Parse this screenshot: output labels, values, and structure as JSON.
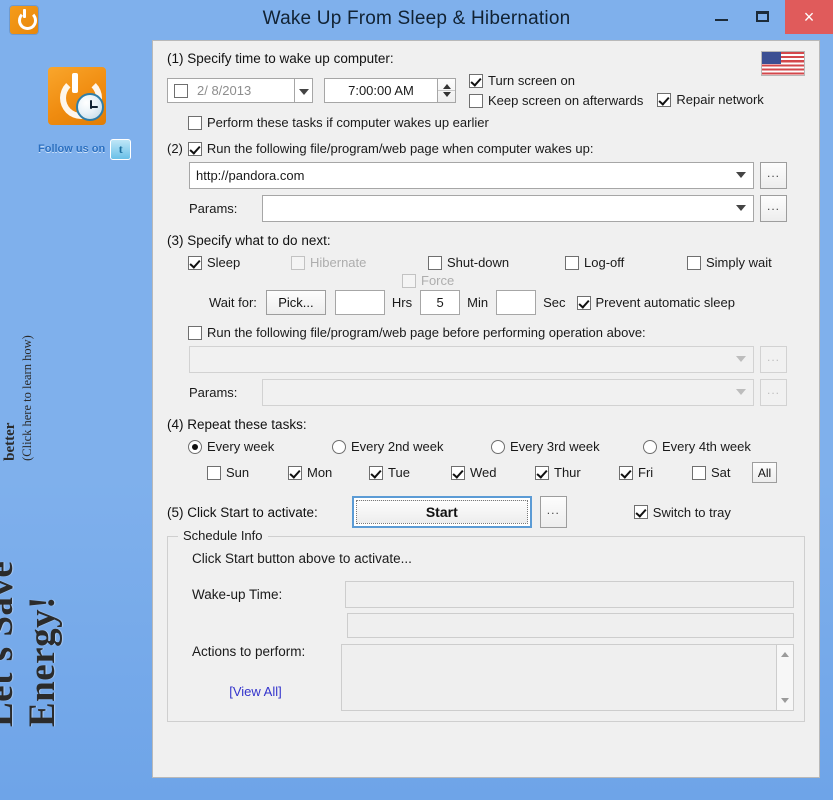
{
  "window": {
    "title": "Wake Up From Sleep & Hibernation",
    "minimize_label": "Minimize",
    "maximize_label": "Maximize",
    "close_label": "×"
  },
  "sidebar": {
    "follow_text": "Follow us on",
    "twitter_glyph": "t",
    "banner_line1": "Let's Save Energy!",
    "banner_line2": "& make this software better",
    "banner_line3": "(Click here to learn how)"
  },
  "section1": {
    "title": "(1) Specify time to wake up computer:",
    "date_enabled": false,
    "date_value": "2/ 8/2013",
    "time_value": "7:00:00 AM",
    "turn_screen_on": {
      "label": "Turn screen on",
      "checked": true
    },
    "keep_screen_on": {
      "label": "Keep screen on afterwards",
      "checked": false
    },
    "repair_network": {
      "label": "Repair network",
      "checked": true
    },
    "perform_earlier": {
      "label": "Perform these tasks if computer wakes up earlier",
      "checked": false
    },
    "flag_icon": "us-flag-icon"
  },
  "section2": {
    "title": "Run the following file/program/web page when computer wakes up:",
    "number": "(2)",
    "checked": true,
    "url_value": "http://pandora.com",
    "params_label": "Params:",
    "params_value": "",
    "browse_label": "..."
  },
  "section3": {
    "title": "(3) Specify what to do next:",
    "options": [
      {
        "label": "Sleep",
        "checked": true,
        "disabled": false
      },
      {
        "label": "Hibernate",
        "checked": false,
        "disabled": true
      },
      {
        "label": "Shut-down",
        "checked": false,
        "disabled": false
      },
      {
        "label": "Log-off",
        "checked": false,
        "disabled": false
      },
      {
        "label": "Simply wait",
        "checked": false,
        "disabled": false
      }
    ],
    "wait_for_label": "Wait for:",
    "pick_label": "Pick...",
    "hrs_value": "",
    "hrs_label": "Hrs",
    "min_value": "5",
    "min_label": "Min",
    "sec_value": "",
    "sec_label": "Sec",
    "force": {
      "label": "Force",
      "checked": false,
      "disabled": true
    },
    "prevent_sleep": {
      "label": "Prevent automatic sleep",
      "checked": true
    },
    "pre_run": {
      "label": "Run the following file/program/web page before performing operation above:",
      "checked": false
    },
    "pre_path_value": "",
    "pre_params_label": "Params:",
    "pre_params_value": "",
    "browse_label": "..."
  },
  "section4": {
    "title": "(4) Repeat these tasks:",
    "frequencies": [
      {
        "label": "Every week",
        "selected": true
      },
      {
        "label": "Every 2nd week",
        "selected": false
      },
      {
        "label": "Every 3rd week",
        "selected": false
      },
      {
        "label": "Every 4th week",
        "selected": false
      }
    ],
    "days": [
      {
        "label": "Sun",
        "checked": false
      },
      {
        "label": "Mon",
        "checked": true
      },
      {
        "label": "Tue",
        "checked": true
      },
      {
        "label": "Wed",
        "checked": true
      },
      {
        "label": "Thur",
        "checked": true
      },
      {
        "label": "Fri",
        "checked": true
      },
      {
        "label": "Sat",
        "checked": false
      }
    ],
    "all_label": "All"
  },
  "section5": {
    "title": "(5) Click Start to activate:",
    "start_label": "Start",
    "browse_label": "...",
    "switch_tray": {
      "label": "Switch to tray",
      "checked": true
    }
  },
  "schedule_info": {
    "group_title": "Schedule Info",
    "status_text": "Click Start button above to activate...",
    "wakeup_label": "Wake-up Time:",
    "wakeup_value": "",
    "wakeup_value2": "",
    "actions_label": "Actions to perform:",
    "actions_value": "",
    "view_all_label": "[View All]"
  },
  "colors": {
    "titlebar": "#7fb0ec",
    "close_button": "#e05b5b",
    "panel_bg": "#f0f0f0",
    "accent_link": "#3333cc",
    "logo_orange": "#f08c10"
  }
}
